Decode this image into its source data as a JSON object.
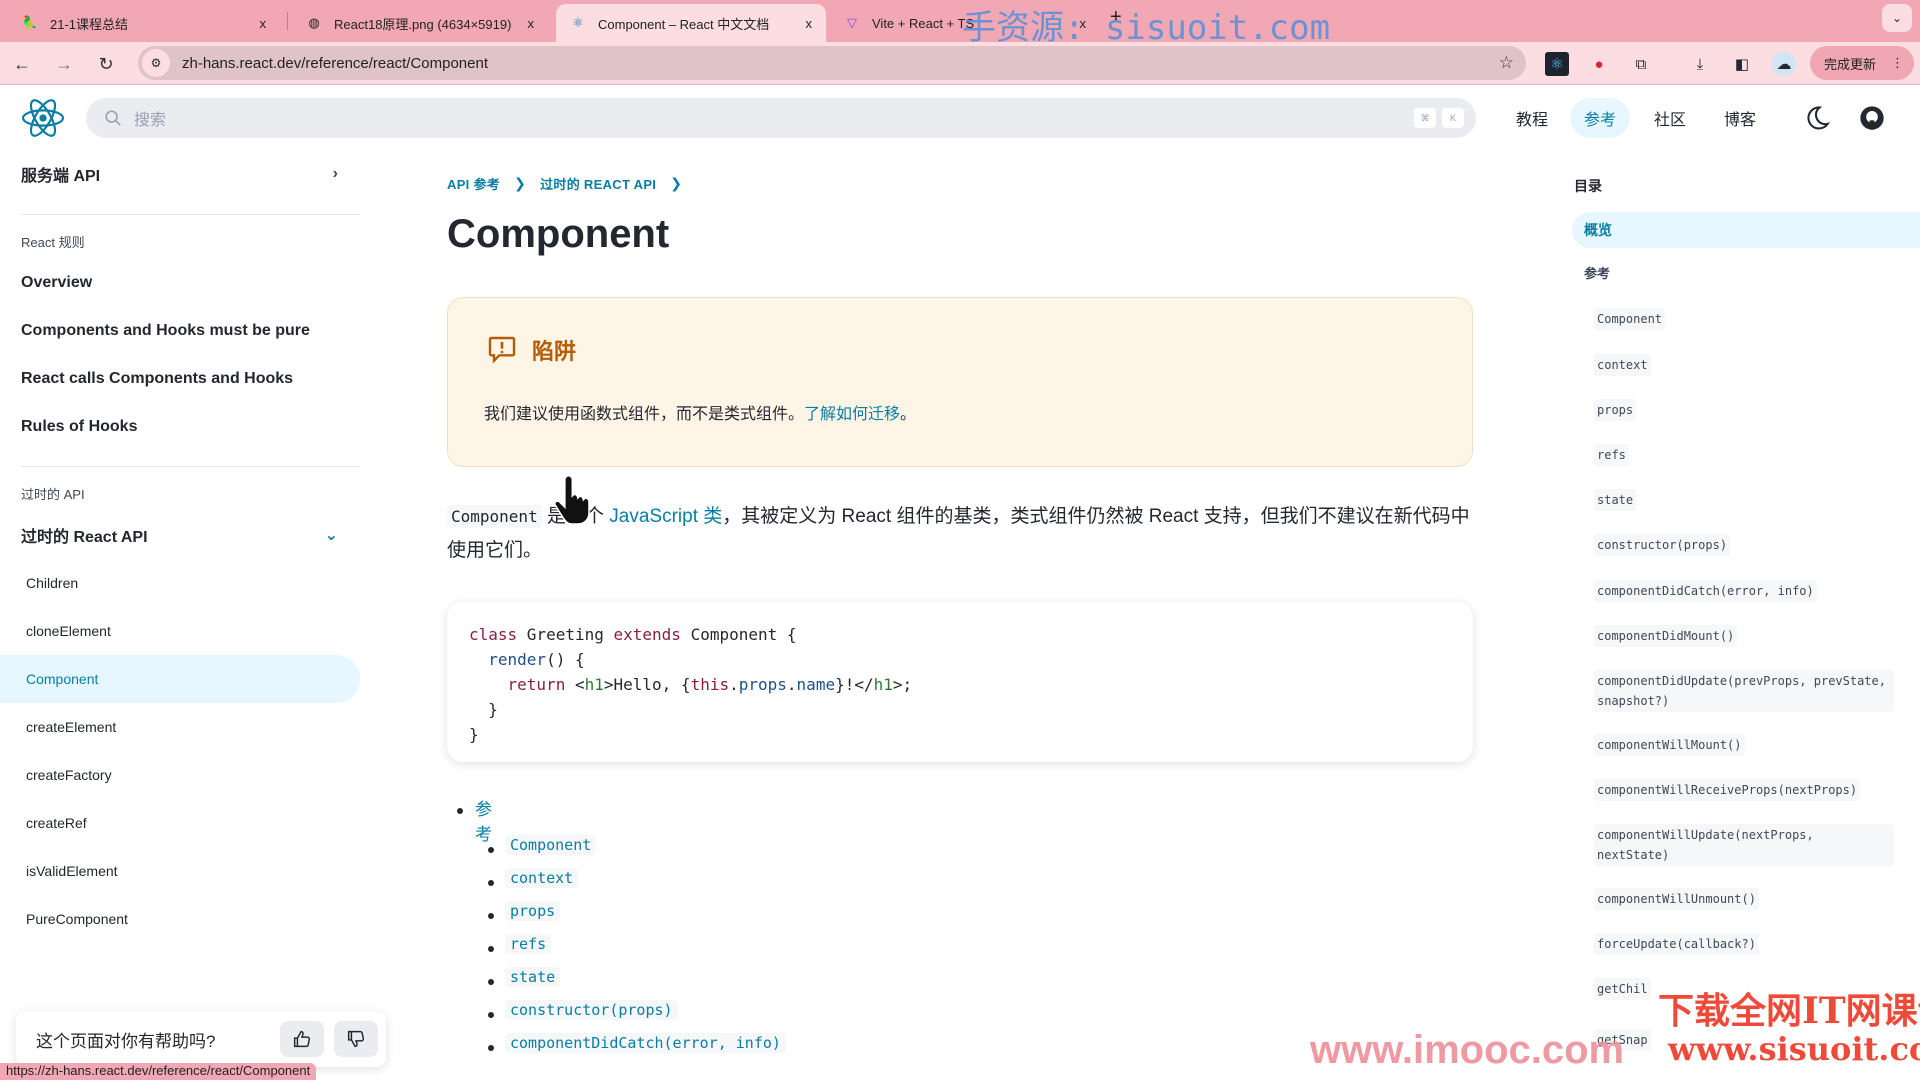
{
  "browser": {
    "tabs": [
      {
        "label": "21-1课程总结",
        "icon": "course-icon",
        "active": false
      },
      {
        "label": "React18原理.png (4634×5919)",
        "icon": "globe-icon",
        "active": false
      },
      {
        "label": "Component – React 中文文档",
        "icon": "react-icon",
        "active": true
      },
      {
        "label": "Vite + React + TS",
        "icon": "vite-icon",
        "active": false
      }
    ],
    "close_glyph": "x",
    "new_tab_glyph": "+",
    "url": "zh-hans.react.dev/reference/react/Component",
    "update_button": "完成更新",
    "status_url": "https://zh-hans.react.dev/reference/react/Component"
  },
  "header": {
    "search_placeholder": "搜索",
    "kbd": [
      "⌘",
      "K"
    ],
    "nav": [
      {
        "label": "教程",
        "active": false
      },
      {
        "label": "参考",
        "active": true
      },
      {
        "label": "社区",
        "active": false
      },
      {
        "label": "博客",
        "active": false
      }
    ]
  },
  "sidebar": {
    "server_api": "服务端 API",
    "rules_head": "React 规则",
    "rules": [
      "Overview",
      "Components and Hooks must be pure",
      "React calls Components and Hooks",
      "Rules of Hooks"
    ],
    "legacy_head": "过时的 API",
    "legacy_section": "过时的 React API",
    "legacy_items": [
      {
        "label": "Children",
        "active": false
      },
      {
        "label": "cloneElement",
        "active": false
      },
      {
        "label": "Component",
        "active": true
      },
      {
        "label": "createElement",
        "active": false
      },
      {
        "label": "createFactory",
        "active": false
      },
      {
        "label": "createRef",
        "active": false
      },
      {
        "label": "isValidElement",
        "active": false
      },
      {
        "label": "PureComponent",
        "active": false
      }
    ]
  },
  "main": {
    "breadcrumbs": [
      "API 参考",
      "过时的 REACT API"
    ],
    "title": "Component",
    "pitfall": {
      "title": "陷阱",
      "body": "我们建议使用函数式组件，而不是类式组件。",
      "link": "了解如何迁移",
      "end": "。"
    },
    "intro": {
      "code": "Component",
      "text1": " 是一个 ",
      "link": "JavaScript 类",
      "text2": "，其被定义为 React 组件的基类，类式组件仍然被 React 支持，但我们不建议在新代码中使用它们。"
    },
    "code_lines": [
      "class Greeting extends Component {",
      "  render() {",
      "    return <h1>Hello, {this.props.name}!</h1>;",
      "  }",
      "}"
    ],
    "toc_heading": "参考",
    "toc_items": [
      "Component",
      "context",
      "props",
      "refs",
      "state",
      "constructor(props)",
      "componentDidCatch(error, info)"
    ]
  },
  "right_toc": {
    "heading": "目录",
    "items": [
      {
        "label": "概览",
        "active": true,
        "code": false
      },
      {
        "label": "参考",
        "active": false,
        "code": false
      },
      {
        "label": "Component",
        "code": true
      },
      {
        "label": "context",
        "code": true
      },
      {
        "label": "props",
        "code": true
      },
      {
        "label": "refs",
        "code": true
      },
      {
        "label": "state",
        "code": true
      },
      {
        "label": "constructor(props)",
        "code": true
      },
      {
        "label": "componentDidCatch(error, info)",
        "code": true
      },
      {
        "label": "componentDidMount()",
        "code": true
      },
      {
        "label": "componentDidUpdate(prevProps, prevState, snapshot?)",
        "code": true
      },
      {
        "label": "componentWillMount()",
        "code": true
      },
      {
        "label": "componentWillReceiveProps(nextProps)",
        "code": true
      },
      {
        "label": "componentWillUpdate(nextProps, nextState)",
        "code": true
      },
      {
        "label": "componentWillUnmount()",
        "code": true
      },
      {
        "label": "forceUpdate(callback?)",
        "code": true
      },
      {
        "label": "getChil",
        "code": true
      },
      {
        "label": "getSnap",
        "code": true
      }
    ]
  },
  "feedback": {
    "question": "这个页面对你有帮助吗?"
  },
  "watermarks": [
    "手资源: sisuoit.com",
    "下载全网IT网课请到",
    "www.sisuoit.com",
    "www.imooc.com"
  ],
  "colors": {
    "accent": "#087ea4",
    "pitfall": "#b35c00",
    "pitfall_bg": "#fef5e7",
    "tab_bar": "#f2a8b4"
  }
}
